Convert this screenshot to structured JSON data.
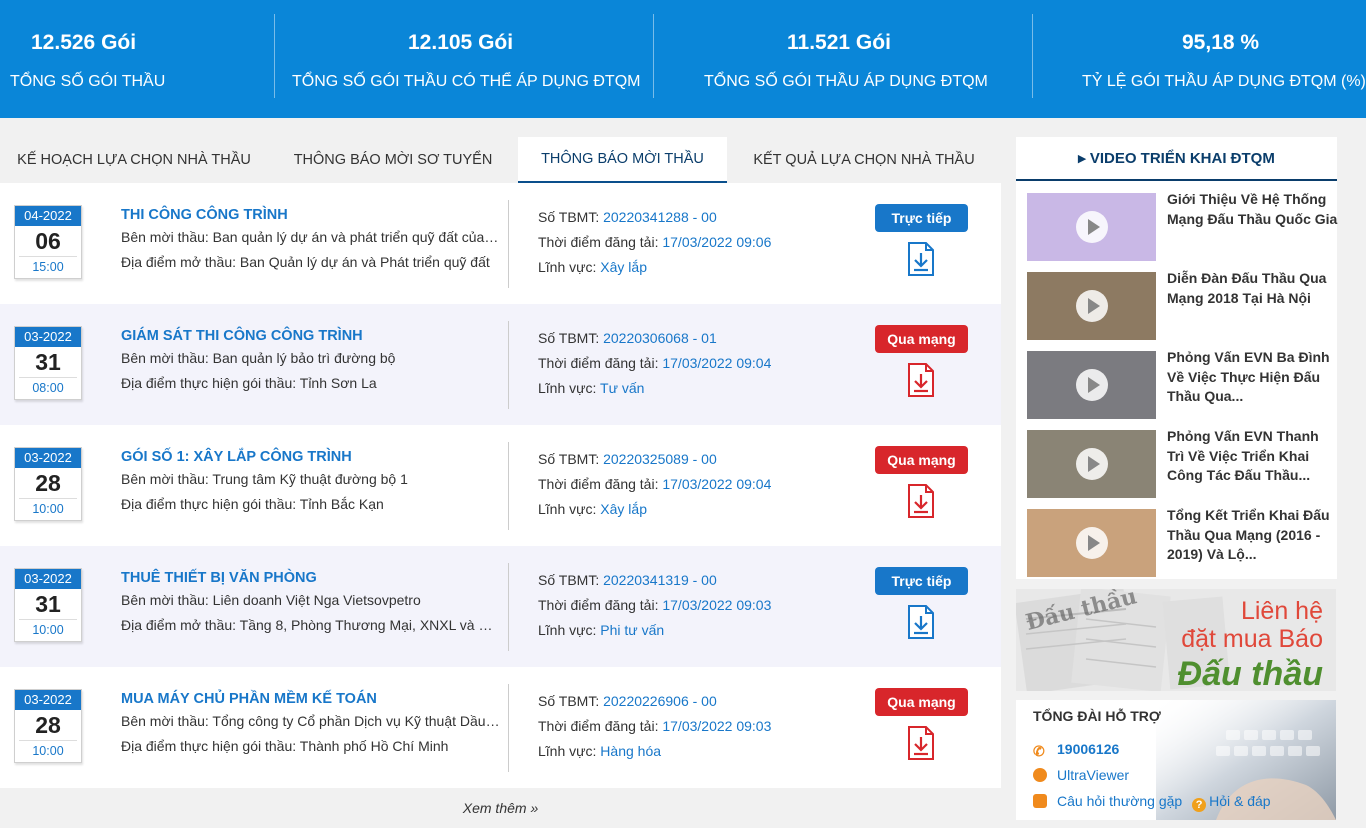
{
  "stats": [
    {
      "value": "12.526 Gói",
      "label": "TỔNG SỐ GÓI THẦU"
    },
    {
      "value": "12.105 Gói",
      "label": "TỔNG SỐ GÓI THẦU CÓ THỂ ÁP DỤNG ĐTQM"
    },
    {
      "value": "11.521 Gói",
      "label": "TỔNG SỐ GÓI THẦU ÁP DỤNG ĐTQM"
    },
    {
      "value": "95,18 %",
      "label": "TỶ LỆ GÓI THẦU ÁP DỤNG ĐTQM (%)"
    }
  ],
  "tabs": [
    {
      "label": "KẾ HOẠCH LỰA CHỌN NHÀ THẦU"
    },
    {
      "label": "THÔNG BÁO MỜI SƠ TUYỂN"
    },
    {
      "label": "THÔNG BÁO MỜI THẦU",
      "active": true
    },
    {
      "label": "KẾT QUẢ LỰA CHỌN NHÀ THẦU"
    }
  ],
  "labels": {
    "tbmt": "Số TBMT: ",
    "posted": "Thời điểm đăng tải: ",
    "field": "Lĩnh vực: "
  },
  "notices": [
    {
      "month": "04-2022",
      "day": "06",
      "time": "15:00",
      "title": "THI CÔNG CÔNG TRÌNH",
      "inviter": "Bên mời thầu: Ban quản lý dự án và phát triển quỹ đất của thành phố",
      "location": "Địa điểm mở thầu: Ban Quản lý dự án và Phát triển quỹ đất",
      "tbmt": "20220341288 - 00",
      "posted": "17/03/2022 09:06",
      "field": "Xây lắp",
      "badge": "Trực tiếp",
      "badge_color": "#1877c9"
    },
    {
      "month": "03-2022",
      "day": "31",
      "time": "08:00",
      "title": "GIÁM SÁT THI CÔNG CÔNG TRÌNH",
      "inviter": "Bên mời thầu: Ban quản lý bảo trì đường bộ",
      "location": "Địa điểm thực hiện gói thầu: Tỉnh Sơn La",
      "tbmt": "20220306068 - 01",
      "posted": "17/03/2022 09:04",
      "field": "Tư vấn",
      "badge": "Qua mạng",
      "badge_color": "#d8262b"
    },
    {
      "month": "03-2022",
      "day": "28",
      "time": "10:00",
      "title": "GÓI SỐ 1: XÂY LẮP CÔNG TRÌNH",
      "inviter": "Bên mời thầu: Trung tâm Kỹ thuật đường bộ 1",
      "location": "Địa điểm thực hiện gói thầu: Tỉnh Bắc Kạn",
      "tbmt": "20220325089 - 00",
      "posted": "17/03/2022 09:04",
      "field": "Xây lắp",
      "badge": "Qua mạng",
      "badge_color": "#d8262b"
    },
    {
      "month": "03-2022",
      "day": "31",
      "time": "10:00",
      "title": "THUÊ THIẾT BỊ VĂN PHÒNG",
      "inviter": "Bên mời thầu: Liên doanh Việt Nga Vietsovpetro",
      "location": "Địa điểm mở thầu: Tầng 8, Phòng Thương Mại, XNXL và Dịch vụ",
      "tbmt": "20220341319 - 00",
      "posted": "17/03/2022 09:03",
      "field": "Phi tư vấn",
      "badge": "Trực tiếp",
      "badge_color": "#1877c9"
    },
    {
      "month": "03-2022",
      "day": "28",
      "time": "10:00",
      "title": "MUA MÁY CHỦ PHẦN MỀM KẾ TOÁN",
      "inviter": "Bên mời thầu: Tổng công ty Cổ phần Dịch vụ Kỹ thuật Dầu khí",
      "location": "Địa điểm thực hiện gói thầu: Thành phố Hồ Chí Minh",
      "tbmt": "20220226906 - 00",
      "posted": "17/03/2022 09:03",
      "field": "Hàng hóa",
      "badge": "Qua mạng",
      "badge_color": "#d8262b"
    }
  ],
  "more_label": "Xem thêm »",
  "videos": {
    "heading": "▸ VIDEO TRIỂN KHAI ĐTQM",
    "items": [
      {
        "title": "Giới Thiệu Về Hệ Thống Mạng Đấu Thầu Quốc Gia",
        "thumb": "#c9b8e6"
      },
      {
        "title": "Diễn Đàn Đấu Thầu Qua Mạng 2018 Tại Hà Nội",
        "thumb": "#8d7a62"
      },
      {
        "title": "Phỏng Vấn EVN Ba Đình Về Việc Thực Hiện Đấu Thầu Qua...",
        "thumb": "#7b7b80"
      },
      {
        "title": "Phỏng Vấn EVN Thanh Trì Về Việc Triển Khai Công Tác Đấu Thầu...",
        "thumb": "#8a8475"
      },
      {
        "title": "Tổng Kết Triển Khai Đấu Thầu Qua Mạng (2016 - 2019) Và Lộ...",
        "thumb": "#c9a27c"
      }
    ]
  },
  "ad": {
    "line1": "Liên hệ",
    "line2": "đặt mua Báo",
    "line3": "Đấu thầu",
    "masthead": "Đấu thầu"
  },
  "support": {
    "title": "TỔNG ĐÀI HỖ TRỢ",
    "phone": "19006126",
    "ultraviewer": "UltraViewer",
    "faq": "Câu hỏi thường gặp",
    "qa": "Hỏi & đáp"
  },
  "colors": {
    "banner": "#0a86d8",
    "link": "#1877c9",
    "red_badge": "#d8262b",
    "blue_badge": "#1877c9",
    "ad_red": "#e0483a",
    "ad_green": "#4f8f2f"
  }
}
